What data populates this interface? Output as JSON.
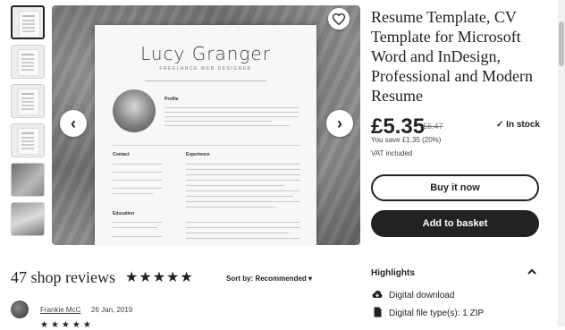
{
  "listing": {
    "title": "Resume Template, CV Template for Microsoft Word and InDesign, Professional and Modern Resume",
    "price": "£5.35",
    "old_price": "£6.47",
    "stock": "In stock",
    "savings": "You save £1.35 (20%)",
    "vat": "VAT included",
    "buy_label": "Buy it now",
    "basket_label": "Add to basket"
  },
  "gallery": {
    "preview_name": "Lucy Granger",
    "preview_role": "FREELANCE WEB DESIGNER",
    "section_profile": "Profile",
    "section_contact": "Contact",
    "section_experience": "Experience",
    "section_education": "Education",
    "prev_icon": "chevron-left-icon",
    "next_icon": "chevron-right-icon",
    "favorite_icon": "heart-icon"
  },
  "highlights": {
    "title": "Highlights",
    "items": [
      {
        "icon": "download-cloud-icon",
        "label": "Digital download"
      },
      {
        "icon": "file-icon",
        "label": "Digital file type(s): 1 ZIP"
      }
    ]
  },
  "reviews": {
    "title": "47 shop reviews",
    "stars": "★★★★★",
    "sort_label": "Sort by: Recommended",
    "first_review": {
      "author": "Frankie McC",
      "date": "26 Jan, 2019",
      "stars": "★★★★★"
    }
  }
}
